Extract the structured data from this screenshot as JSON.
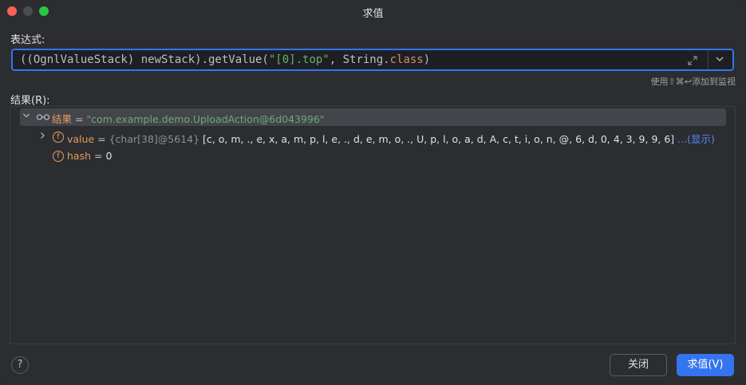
{
  "window": {
    "title": "求值"
  },
  "expression": {
    "label": "表达式:",
    "code_prefix": "((OgnlValueStack) newStack).getValue(",
    "code_string": "\"[0].top\"",
    "code_mid": ", String.",
    "code_keyword": "class",
    "code_suffix": ")",
    "hint": "使用⇧⌘↩添加到监视"
  },
  "result": {
    "label": "结果(R):",
    "root": {
      "name": "结果",
      "eq": " = ",
      "value": "\"com.example.demo.UploadAction@6d043996\""
    },
    "children": [
      {
        "icon": "field-icon",
        "name": "value",
        "eq": " = ",
        "type": "{char[38]@5614}",
        "value": " [c, o, m, ., e, x, a, m, p, l, e, ., d, e, m, o, ., U, p, l, o, a, d, A, c, t, i, o, n, @, 6, d, 0, 4, 3, 9, 9, 6]",
        "more": " ...(显示)"
      },
      {
        "icon": "field-icon",
        "name": "hash",
        "eq": " = ",
        "value": "0"
      }
    ]
  },
  "buttons": {
    "close": "关闭",
    "evaluate": "求值(V)",
    "help": "?"
  },
  "colors": {
    "accent": "#3574f0",
    "string": "#6aab73",
    "field": "#e59b5b",
    "keyword": "#cf8e6d"
  }
}
